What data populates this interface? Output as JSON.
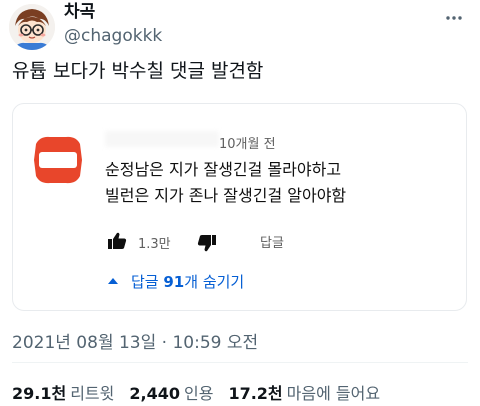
{
  "author": {
    "display_name": "차곡",
    "handle": "@chagokkk"
  },
  "tweet": {
    "text": "유튭 보다가 박수칠 댓글 발견함"
  },
  "embedded_comment": {
    "time_ago": "10개월 전",
    "lines": [
      "순정남은 지가 잘생긴걸 몰라야하고",
      "빌런은 지가 존나 잘생긴걸 알아야함"
    ],
    "like_count": "1.3만",
    "reply_label": "답글",
    "toggle_label_prefix": "답글 ",
    "toggle_count": "91",
    "toggle_label_suffix": "개 숨기기"
  },
  "meta": {
    "timestamp": "2021년 08월 13일 · 10:59 오전"
  },
  "stats": {
    "retweets_value": "29.1천",
    "retweets_label": "리트윗",
    "quotes_value": "2,440",
    "quotes_label": "인용",
    "likes_value": "17.2천",
    "likes_label": "마음에 들어요"
  },
  "colors": {
    "link_blue": "#065fd4",
    "secondary_text": "#536471",
    "yt_avatar_red": "#e8462b"
  },
  "icons": {
    "more": "more-horizontal-icon",
    "like": "thumbs-up-icon",
    "dislike": "thumbs-down-icon",
    "caret": "caret-up-icon"
  }
}
